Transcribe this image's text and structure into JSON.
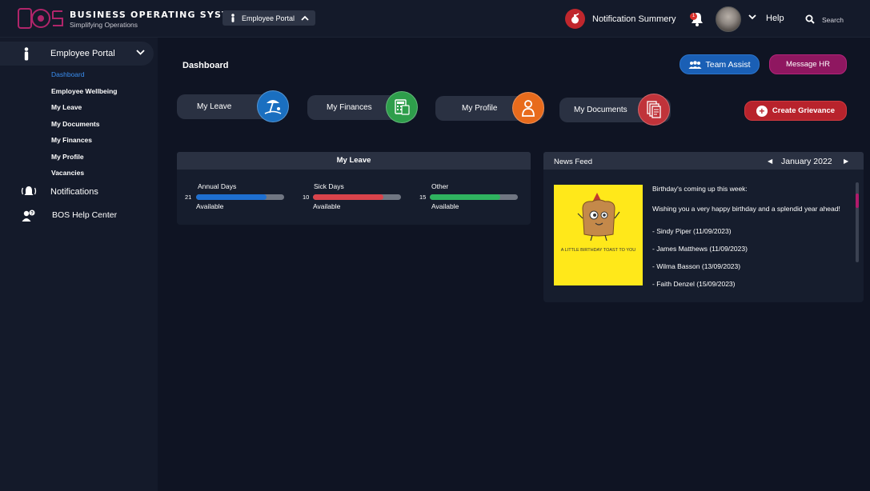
{
  "header": {
    "brand_title": "BUSINESS OPERATING SYSTEM",
    "brand_subtitle": "Simplifying Operations",
    "portal_selector": "Employee Portal",
    "notification_label": "Notification Summery",
    "bell_badge": "1",
    "help_label": "Help",
    "search_label": "Search"
  },
  "sidebar": {
    "portal_label": "Employee Portal",
    "items": [
      {
        "label": "Dashboard",
        "active": true
      },
      {
        "label": "Employee Wellbeing"
      },
      {
        "label": "My Leave"
      },
      {
        "label": "My Documents"
      },
      {
        "label": "My Finances"
      },
      {
        "label": "My Profile"
      },
      {
        "label": "Vacancies"
      }
    ],
    "notifications_label": "Notifications",
    "help_center_label": "BOS Help Center"
  },
  "main": {
    "title": "Dashboard",
    "team_assist": "Team Assist",
    "message_hr": "Message HR",
    "create_grievance": "Create Grievance",
    "tiles": [
      {
        "label": "My Leave",
        "icon": "beach-icon",
        "color": "#1a6fc0"
      },
      {
        "label": "My Finances",
        "icon": "calculator-icon",
        "color": "#2e9e4b"
      },
      {
        "label": "My Profile",
        "icon": "person-icon",
        "color": "#e86b1c"
      },
      {
        "label": "My Documents",
        "icon": "documents-icon",
        "color": "#c0333a"
      }
    ]
  },
  "leave": {
    "title": "My Leave",
    "items": [
      {
        "label": "Annual Days",
        "count": "21",
        "status": "Available",
        "fraction": 0.8,
        "color": "#1e6fd0"
      },
      {
        "label": "Sick Days",
        "count": "10",
        "status": "Available",
        "fraction": 0.8,
        "color": "#d9434b"
      },
      {
        "label": "Other",
        "count": "15",
        "status": "Available",
        "fraction": 0.8,
        "color": "#2fb35f"
      }
    ]
  },
  "news": {
    "title": "News Feed",
    "month": "January 2022",
    "image_caption": "A LITTLE BIRTHDAY TOAST TO YOU",
    "heading": "Birthday's coming up this week:",
    "wish": "Wishing you a very happy birthday and a splendid year ahead!",
    "people": [
      "- Sindy Piper (11/09/2023)",
      "- James Matthews (11/09/2023)",
      "- Wilma Basson (13/09/2023)",
      "- Faith Denzel (15/09/2023)"
    ]
  }
}
